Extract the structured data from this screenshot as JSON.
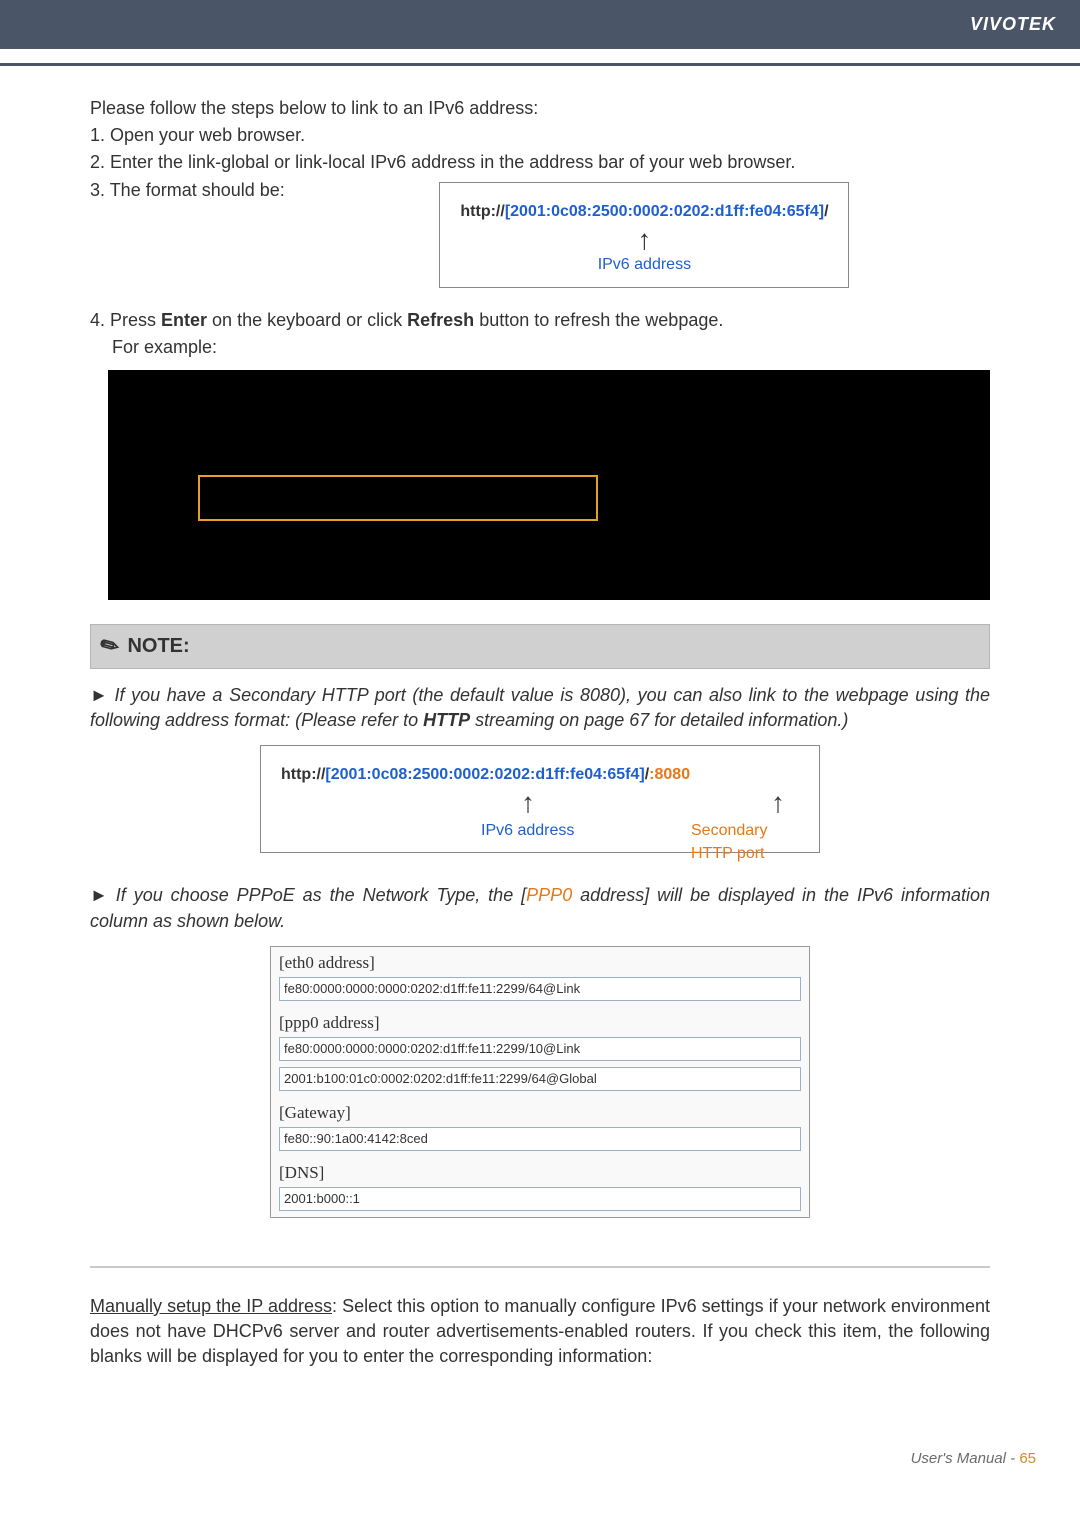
{
  "brand": "VIVOTEK",
  "intro": "Please follow the steps below to link to an IPv6 address:",
  "step1": "1. Open your web browser.",
  "step2": "2. Enter the link-global or link-local IPv6 address in the address bar of your web browser.",
  "step3": "3. The format should be:",
  "step4a": "4. Press ",
  "step4b": "Enter",
  "step4c": " on the keyboard or click ",
  "step4d": "Refresh",
  "step4e": " button to refresh the webpage.",
  "step4f": "For example:",
  "url1": {
    "prefix": "http://",
    "addr": "[2001:0c08:2500:0002:0202:d1ff:fe04:65f4]",
    "suffix": "/",
    "label": "IPv6 address"
  },
  "note": {
    "title": "NOTE:",
    "p1a": "► If you have a Secondary HTTP port (the default value is 8080), you can also link to the webpage using the following address format: (Please refer to ",
    "p1b": "HTTP",
    "p1c": " streaming on page 67 for detailed information.)",
    "p2a": "► If you choose PPPoE as the Network Type, the [",
    "p2b": "PPP0",
    "p2c": " address] will be displayed in the IPv6 information column as shown below."
  },
  "url2": {
    "prefix": "http://",
    "addr": "[2001:0c08:2500:0002:0202:d1ff:fe04:65f4]",
    "mid": "/",
    "port": ":8080",
    "label1": "IPv6 address",
    "label2": "Secondary HTTP port"
  },
  "panel": {
    "eth0_lab": "[eth0 address]",
    "eth0_val": "fe80:0000:0000:0000:0202:d1ff:fe11:2299/64@Link",
    "ppp0_lab": "[ppp0 address]",
    "ppp0_val1": "fe80:0000:0000:0000:0202:d1ff:fe11:2299/10@Link",
    "ppp0_val2": "2001:b100:01c0:0002:0202:d1ff:fe11:2299/64@Global",
    "gw_lab": "[Gateway]",
    "gw_val": "fe80::90:1a00:4142:8ced",
    "dns_lab": "[DNS]",
    "dns_val": "2001:b000::1"
  },
  "manual": {
    "head": "Manually setup the IP address",
    "body": ": Select this option to manually configure IPv6 settings if your network environment does not have DHCPv6 server and router advertisements-enabled routers. If you check this item, the following blanks will be displayed for you to enter the corresponding information:"
  },
  "footer": {
    "label": "User's Manual - ",
    "page": "65"
  }
}
